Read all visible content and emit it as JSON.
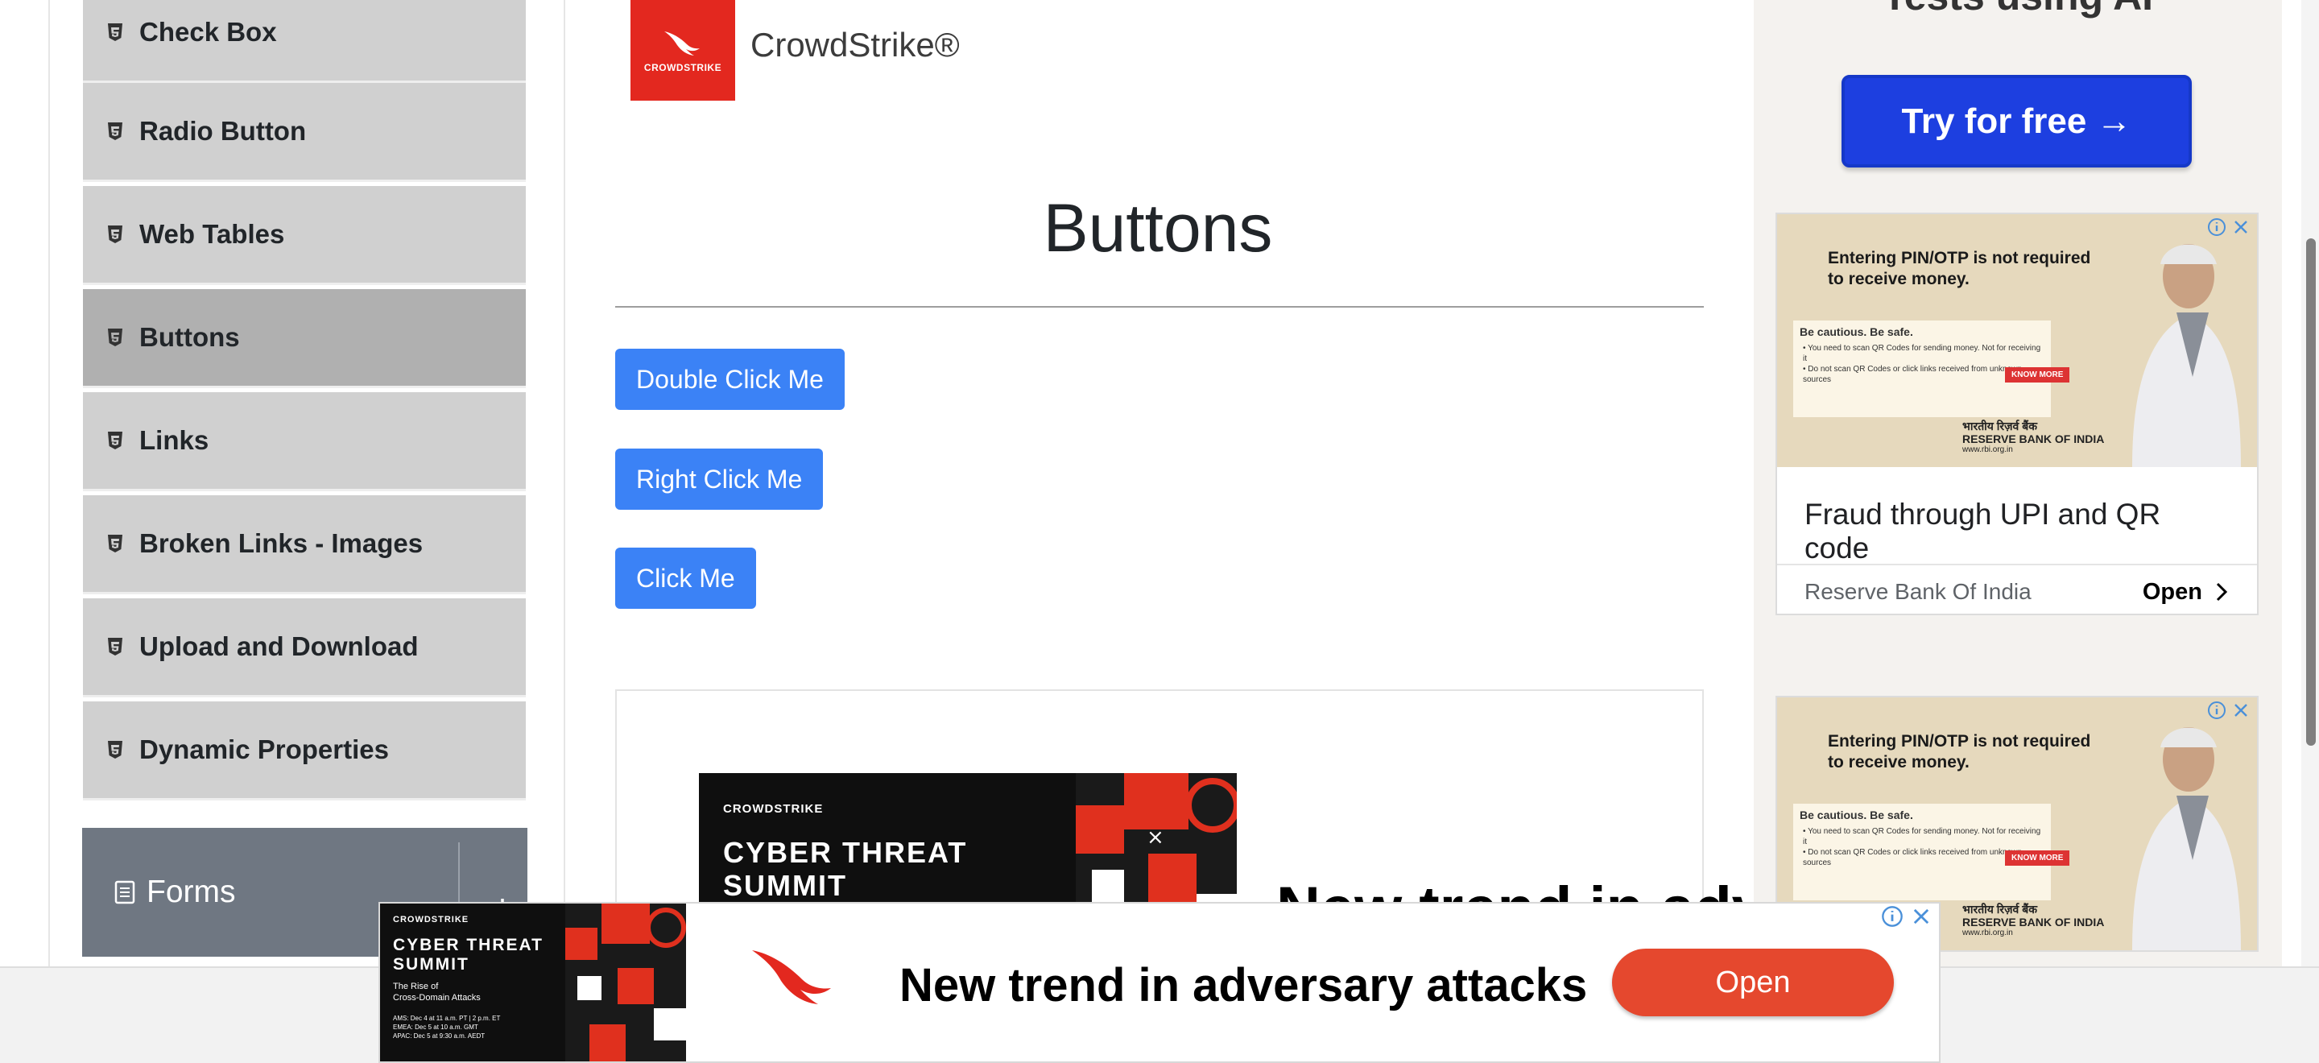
{
  "sidebar": {
    "items": [
      {
        "label": "Check Box"
      },
      {
        "label": "Radio Button"
      },
      {
        "label": "Web Tables"
      },
      {
        "label": "Buttons"
      },
      {
        "label": "Links"
      },
      {
        "label": "Broken Links - Images"
      },
      {
        "label": "Upload and Download"
      },
      {
        "label": "Dynamic Properties"
      }
    ],
    "active_index": 3,
    "group_label": "Forms"
  },
  "brand": {
    "name": "CrowdStrike®",
    "logo_text": "CROWDSTRIKE"
  },
  "main": {
    "title": "Buttons",
    "buttons": {
      "double": "Double Click Me",
      "right": "Right Click Me",
      "click": "Click Me"
    }
  },
  "inline_ad": {
    "logo_text": "CROWDSTRIKE",
    "title_line1": "CYBER THREAT",
    "title_line2": "SUMMIT",
    "headline": "New trend in adver"
  },
  "right_ads": {
    "top_text": "Tests using AI",
    "try_button": "Try for free →",
    "rbi": {
      "headline": "Entering PIN/OTP is not required to receive money.",
      "caution_title": "Be cautious. Be safe.",
      "caution_line1": "• You need to scan QR Codes for sending money. Not for receiving it",
      "caution_line2": "• Do not scan QR Codes or click links received from unknown sources",
      "know_more": "KNOW MORE",
      "bank_hindi": "भारतीय रिज़र्व बैंक",
      "bank_name": "RESERVE BANK OF INDIA",
      "bank_url": "www.rbi.org.in",
      "card_title": "Fraud through UPI and QR code",
      "source": "Reserve Bank Of India",
      "open": "Open"
    }
  },
  "sticky_ad": {
    "logo_text": "CROWDSTRIKE",
    "title_line1": "CYBER THREAT",
    "title_line2": "SUMMIT",
    "sub1": "The Rise of",
    "sub2": "Cross-Domain Attacks",
    "dates": [
      "AMS: Dec 4 at 11 a.m. PT | 2 p.m. ET",
      "EMEA: Dec 5 at 10 a.m. GMT",
      "APAC: Dec 5 at 9:30 a.m. AEDT"
    ],
    "headline": "New trend in adversary attacks",
    "open": "Open"
  },
  "colors": {
    "primary_button": "#3b82f6",
    "sidebar_item": "#d0d0d0",
    "sidebar_active": "#b0b0b0",
    "group_header": "#6f7782",
    "crowdstrike_red": "#e3281f",
    "open_button": "#e5482e",
    "try_button": "#1d3fe0"
  }
}
